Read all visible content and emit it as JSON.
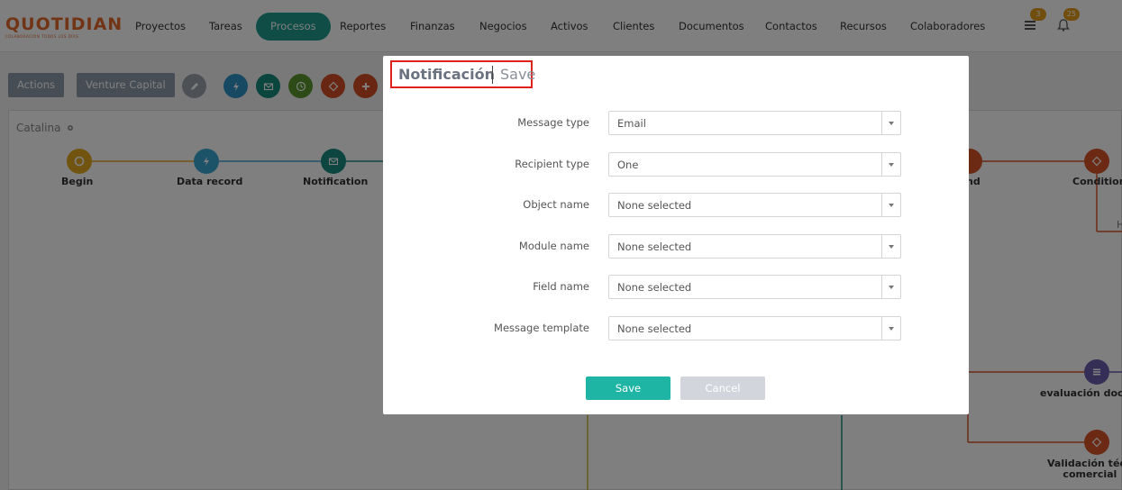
{
  "brand": {
    "name": "QUOTIDIAN",
    "tagline": "COLABORACIÓN TODOS LOS DÍAS"
  },
  "nav": {
    "items": [
      {
        "label": "Proyectos"
      },
      {
        "label": "Tareas"
      },
      {
        "label": "Procesos",
        "active": true
      },
      {
        "label": "Reportes"
      },
      {
        "label": "Finanzas"
      },
      {
        "label": "Negocios"
      },
      {
        "label": "Activos"
      },
      {
        "label": "Clientes"
      },
      {
        "label": "Documentos"
      },
      {
        "label": "Contactos"
      },
      {
        "label": "Recursos"
      },
      {
        "label": "Colaboradores"
      }
    ],
    "list_badge": "3",
    "bell_badge": "25",
    "list_icon": "list-icon",
    "bell_icon": "bell-icon"
  },
  "toolbar": {
    "actions_label": "Actions",
    "vc_label": "Venture Capital"
  },
  "canvas": {
    "title": "Catalina",
    "nodes": [
      {
        "label": "Begin"
      },
      {
        "label": "Data record"
      },
      {
        "label": "Notification"
      },
      {
        "label": "nd"
      },
      {
        "label": "Condition"
      },
      {
        "label": "evaluación docu"
      },
      {
        "label": "Validación técn"
      },
      {
        "label": "comercial"
      },
      {
        "label": "H"
      }
    ]
  },
  "modal": {
    "title": "Notificación",
    "save_link": "Save",
    "fields": [
      {
        "label": "Message type",
        "value": "Email"
      },
      {
        "label": "Recipient type",
        "value": "One"
      },
      {
        "label": "Object name",
        "value": "None selected"
      },
      {
        "label": "Module name",
        "value": "None selected"
      },
      {
        "label": "Field name",
        "value": "None selected"
      },
      {
        "label": "Message template",
        "value": "None selected"
      }
    ],
    "save_label": "Save",
    "cancel_label": "Cancel"
  },
  "colors": {
    "accent": "#1e9a8d",
    "save": "#1fb5a5",
    "cancel": "#d2d6dc",
    "highlight": "#e0221f",
    "brand": "#e26a2c"
  }
}
